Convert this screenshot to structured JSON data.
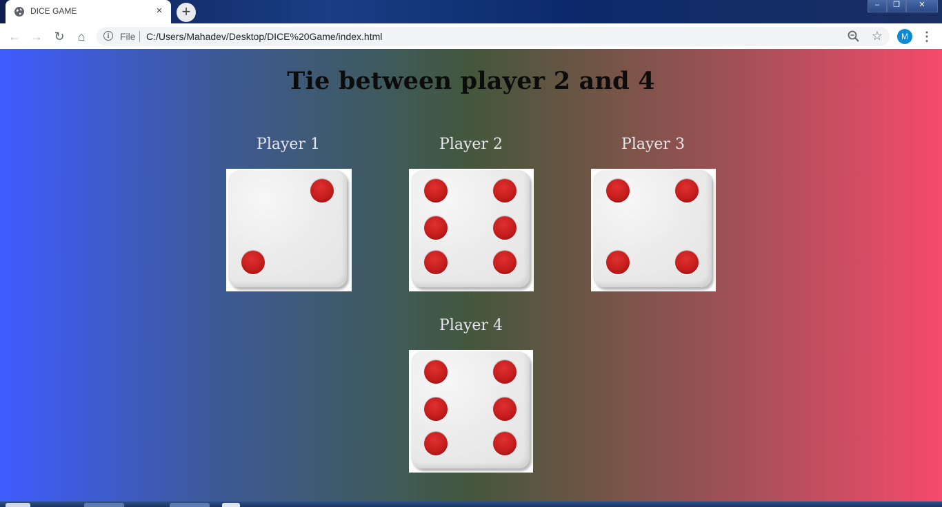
{
  "browser": {
    "tab_title": "DICE GAME",
    "tab_close_glyph": "×",
    "new_tab_glyph": "+",
    "window_controls": [
      "–",
      "❐",
      "✕"
    ],
    "nav": {
      "back": "←",
      "forward": "→",
      "reload": "↻",
      "home": "⌂"
    },
    "omnibox": {
      "scheme_label": "File",
      "url": "C:/Users/Mahadev/Desktop/DICE%20Game/index.html"
    },
    "star_glyph": "☆",
    "menu_glyph": "⋮",
    "avatar_initial": "M",
    "avatar_color": "#0b8ad6"
  },
  "page": {
    "result_title": "Tie between player 2 and 4",
    "gradient_colors": [
      "#3f5cff",
      "#44573c",
      "#f54a6b"
    ],
    "pip_color": "#c51d1d",
    "players": [
      {
        "label": "Player 1",
        "die_value": 2
      },
      {
        "label": "Player 2",
        "die_value": 6
      },
      {
        "label": "Player 3",
        "die_value": 4
      },
      {
        "label": "Player 4",
        "die_value": 6
      }
    ]
  }
}
